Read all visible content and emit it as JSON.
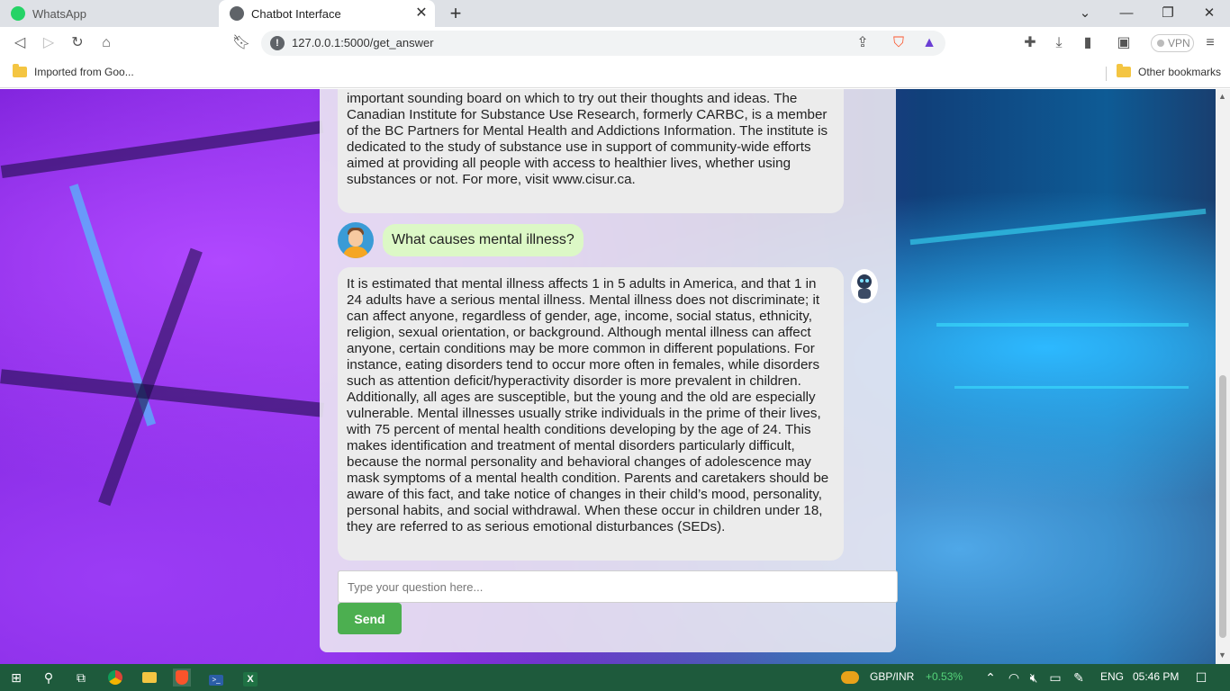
{
  "browser": {
    "tabs": [
      {
        "label": "WhatsApp",
        "active": false
      },
      {
        "label": "Chatbot Interface",
        "active": true
      }
    ],
    "new_tab_symbol": "+",
    "address_url": "127.0.0.1:5000/get_answer",
    "vpn_label": "VPN",
    "bookmarks": [
      {
        "label": "Imported from Goo..."
      },
      {
        "label": "Other bookmarks"
      }
    ]
  },
  "chat": {
    "messages": [
      {
        "role": "bot",
        "text": "important sounding board on which to try out their thoughts and ideas. The Canadian Institute for Substance Use Research, formerly CARBC, is a member of the BC Partners for Mental Health and Addictions Information. The institute is dedicated to the study of substance use in support of community-wide efforts aimed at providing all people with access to healthier lives, whether using substances or not. For more, visit www.cisur.ca."
      },
      {
        "role": "user",
        "text": "What causes mental illness?"
      },
      {
        "role": "bot",
        "text": "It is estimated that mental illness affects 1 in 5 adults in America, and that 1 in 24 adults have a serious mental illness. Mental illness does not discriminate; it can affect anyone, regardless of gender, age, income, social status, ethnicity, religion, sexual orientation, or background. Although mental illness can affect anyone, certain conditions may be more common in different populations. For instance, eating disorders tend to occur more often in females, while disorders such as attention deficit/hyperactivity disorder is more prevalent in children. Additionally, all ages are susceptible, but the young and the old are especially vulnerable. Mental illnesses usually strike individuals in the prime of their lives, with 75 percent of mental health conditions developing by the age of 24. This makes identification and treatment of mental disorders particularly difficult, because the normal personality and behavioral changes of adolescence may mask symptoms of a mental health condition. Parents and caretakers should be aware of this fact, and take notice of changes in their child’s mood, personality, personal habits, and social withdrawal. When these occur in children under 18, they are referred to as serious emotional disturbances (SEDs)."
      }
    ],
    "input": {
      "placeholder": "Type your question here...",
      "value": ""
    },
    "send_label": "Send"
  },
  "taskbar": {
    "ticker_pair": "GBP/INR",
    "ticker_change": "+0.53%",
    "language": "ENG",
    "time": "05:46 PM"
  },
  "colors": {
    "user_bubble": "#dcf8c6",
    "bot_bubble": "#ececec",
    "send_button": "#4caf50",
    "taskbar": "#1e5a3c"
  }
}
